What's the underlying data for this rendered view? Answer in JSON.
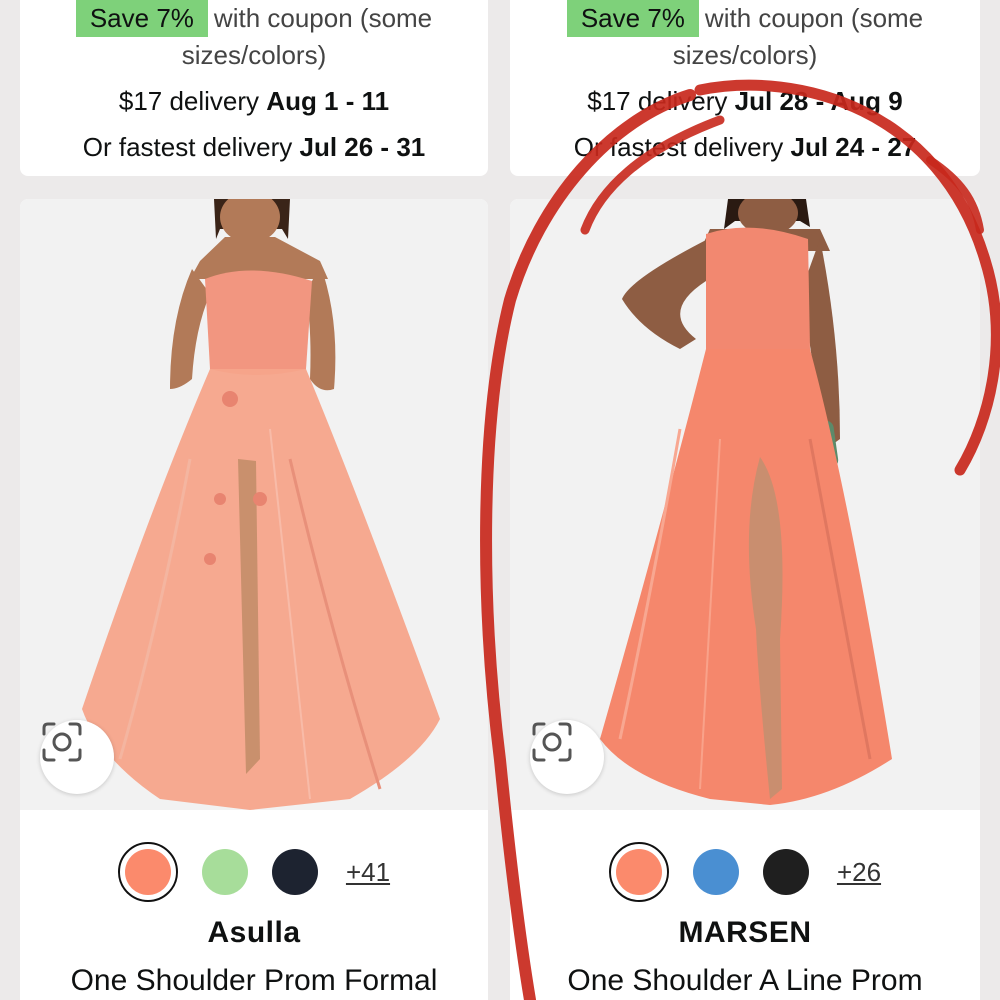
{
  "products": [
    {
      "coupon_badge": "Save 7%",
      "coupon_text_1": "with coupon (some",
      "coupon_text_2": "sizes/colors)",
      "delivery_prefix": "$17 delivery",
      "delivery_date": "Aug 1 - 11",
      "fastest_prefix": "Or fastest delivery",
      "fastest_date": "Jul 26 - 31",
      "swatch_colors": [
        "#fb8a6c",
        "#a7dd9a",
        "#1d2330"
      ],
      "more_colors": "+41",
      "brand": "Asulla",
      "title": "One Shoulder Prom Formal",
      "dress_color": "#f6a48a"
    },
    {
      "coupon_badge": "Save 7%",
      "coupon_text_1": "with coupon (some",
      "coupon_text_2": "sizes/colors)",
      "delivery_prefix": "$17 delivery",
      "delivery_date": "Jul 28 - Aug 9",
      "fastest_prefix": "Or fastest delivery",
      "fastest_date": "Jul 24 - 27",
      "swatch_colors": [
        "#fb8a6c",
        "#4a8fd2",
        "#1f1f1f"
      ],
      "more_colors": "+26",
      "brand": "MARSEN",
      "title": "One Shoulder A Line Prom",
      "dress_color": "#f5876c"
    }
  ],
  "colors": {
    "coupon_green": "#7ed17a",
    "scribble_red": "#c8281c",
    "page_bg": "#eceaea"
  },
  "icons": {
    "lens": "visual-search-icon"
  }
}
